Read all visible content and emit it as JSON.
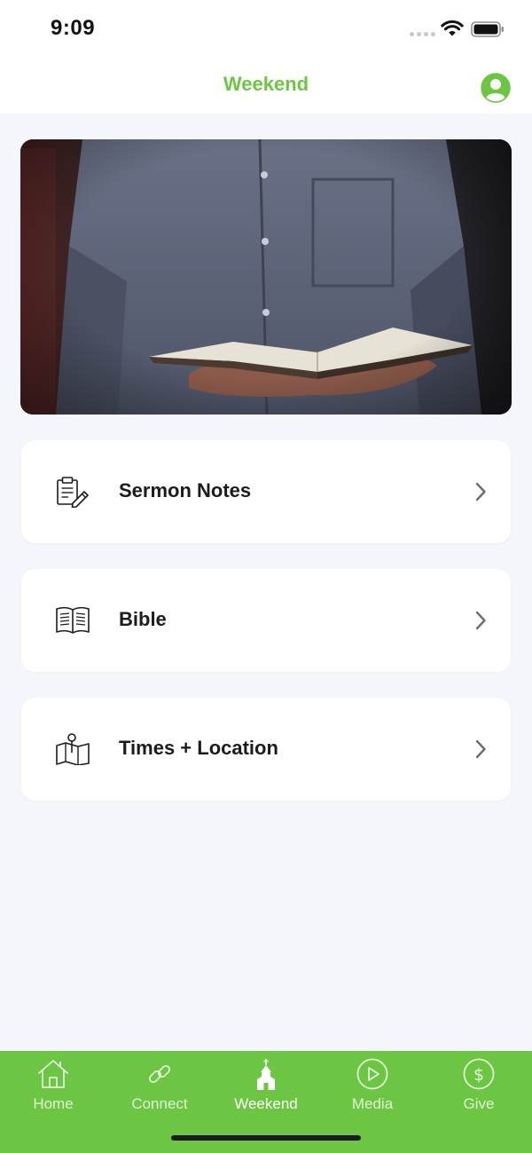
{
  "status_bar": {
    "time": "9:09"
  },
  "nav": {
    "title": "Weekend"
  },
  "hero": {
    "icon": "man-holding-open-bible-photo"
  },
  "menu": [
    {
      "label": "Sermon Notes",
      "icon": "clipboard-edit-icon"
    },
    {
      "label": "Bible",
      "icon": "open-book-icon"
    },
    {
      "label": "Times + Location",
      "icon": "map-pin-icon"
    }
  ],
  "tabs": [
    {
      "label": "Home",
      "icon": "home-icon"
    },
    {
      "label": "Connect",
      "icon": "link-icon"
    },
    {
      "label": "Weekend",
      "icon": "church-icon",
      "active": true
    },
    {
      "label": "Media",
      "icon": "play-circle-icon"
    },
    {
      "label": "Give",
      "icon": "dollar-circle-icon"
    }
  ],
  "colors": {
    "accent": "#6cc644",
    "background": "#f4f6fb",
    "card": "#ffffff",
    "text": "#1c1c1e"
  }
}
